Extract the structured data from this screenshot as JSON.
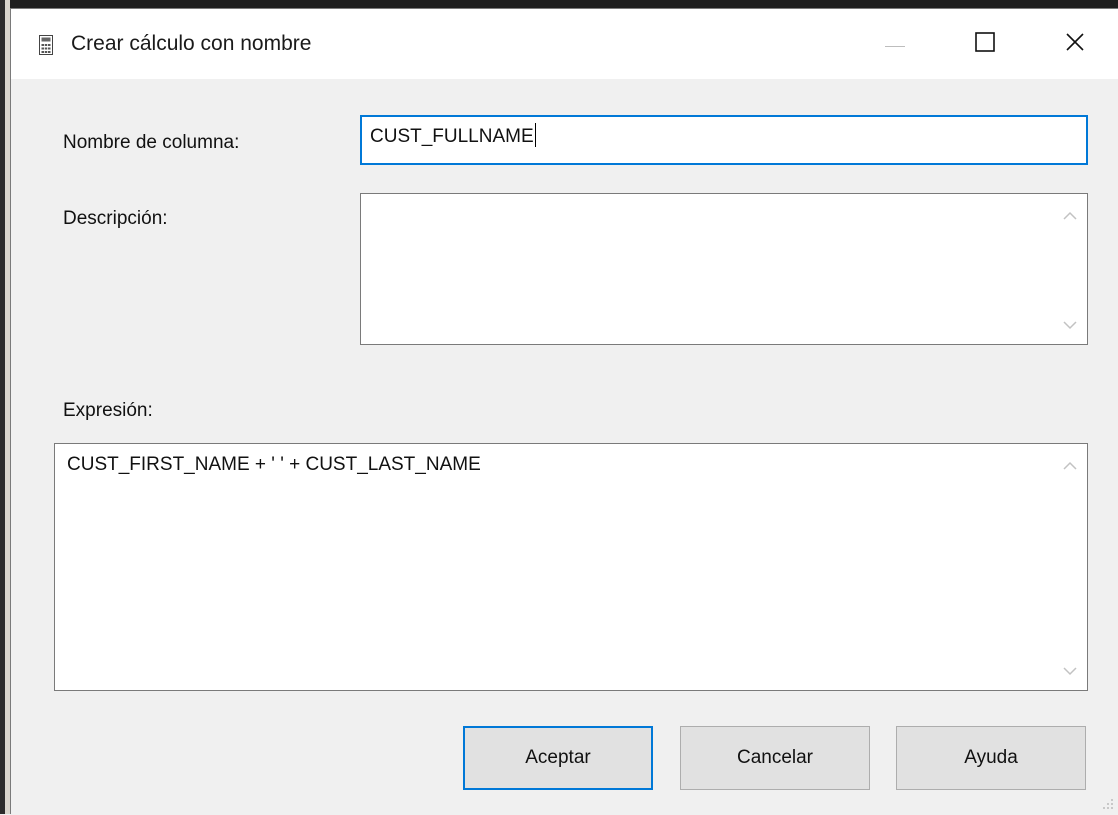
{
  "window": {
    "title": "Crear cálculo con nombre",
    "icon": "calculator-icon"
  },
  "titlebar_buttons": {
    "minimize": "minimize-icon",
    "maximize": "maximize-icon",
    "close": "close-icon"
  },
  "form": {
    "column_name_label": "Nombre de columna:",
    "column_name_value": "CUST_FULLNAME",
    "description_label": "Descripción:",
    "description_value": "",
    "expression_label": "Expresión:",
    "expression_value": "CUST_FIRST_NAME + ' ' + CUST_LAST_NAME"
  },
  "buttons": {
    "ok_label": "Aceptar",
    "cancel_label": "Cancelar",
    "help_label": "Ayuda"
  },
  "colors": {
    "focus_accent": "#0078d7",
    "dialog_background": "#f0f0f0"
  }
}
